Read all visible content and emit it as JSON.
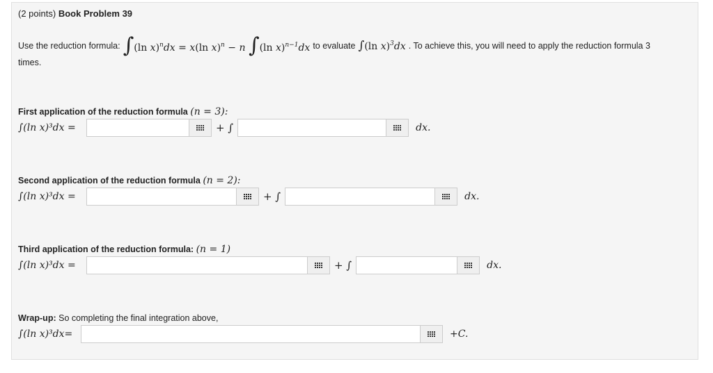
{
  "header": {
    "points": "(2 points)",
    "title": "Book Problem 39"
  },
  "intro": {
    "prefix": "Use the reduction formula:",
    "mid": "to evaluate",
    "suffix": ". To achieve this, you will need to apply the reduction formula 3",
    "line2": "times."
  },
  "sections": [
    {
      "label": "First application of the reduction formula",
      "n_eq": "(n = 3):"
    },
    {
      "label": "Second application of the reduction formula",
      "n_eq": "(n = 2):"
    },
    {
      "label": "Third application of the reduction formula:",
      "n_eq": "(n = 1)"
    },
    {
      "label": "Wrap-up:",
      "rest": "So completing the final integration above,"
    }
  ],
  "math": {
    "lhs_eq": "∫(ln x)³dx =",
    "lhs_eq_wrap": "∫(ln x)³dx=",
    "plus_int": "+ ∫",
    "dx_end": "dx.",
    "plus_c": "+C."
  },
  "answers": {
    "first_a": "",
    "first_b": "",
    "second_a": "",
    "second_b": "",
    "third_a": "",
    "third_b": "",
    "final": ""
  }
}
